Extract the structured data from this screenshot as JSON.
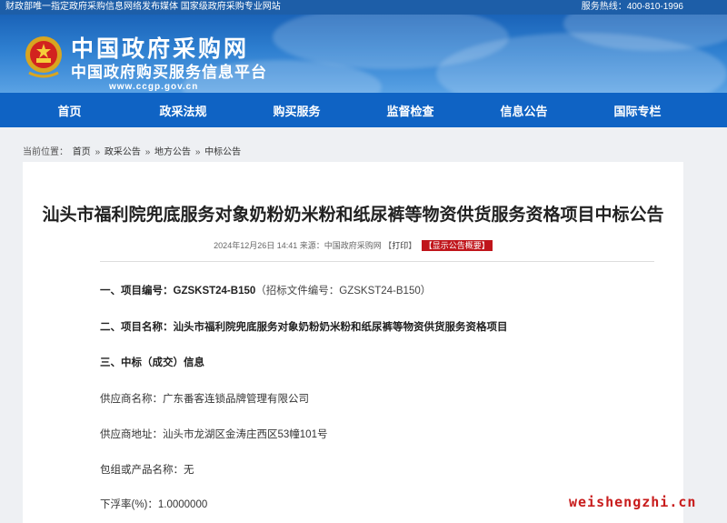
{
  "topbar": {
    "left": "财政部唯一指定政府采购信息网络发布媒体  国家级政府采购专业网站",
    "right": "服务热线：400-810-1996"
  },
  "banner": {
    "title_cn": "中国政府采购网",
    "subtitle_cn": "中国政府购买服务信息平台",
    "url": "www.ccgp.gov.cn"
  },
  "nav": {
    "items": [
      {
        "label": "首页"
      },
      {
        "label": "政采法规"
      },
      {
        "label": "购买服务"
      },
      {
        "label": "监督检查"
      },
      {
        "label": "信息公告"
      },
      {
        "label": "国际专栏"
      }
    ]
  },
  "breadcrumb": {
    "prefix": "当前位置：",
    "items": [
      "首页",
      "政采公告",
      "地方公告",
      "中标公告"
    ],
    "sep": "»"
  },
  "article": {
    "title": "汕头市福利院兜底服务对象奶粉奶米粉和纸尿裤等物资供货服务资格项目中标公告",
    "meta_text": "2024年12月26日 14:41 来源：中国政府采购网 【",
    "print_label": "打印",
    "meta_close": "】",
    "summary_button": "【显示公告概要】",
    "paragraphs": [
      {
        "label": "一、项目编号：",
        "value": "GZSKST24-B150",
        "extra": "（招标文件编号：GZSKST24-B150）"
      },
      {
        "label": "二、项目名称：",
        "value": "汕头市福利院兜底服务对象奶粉奶米粉和纸尿裤等物资供货服务资格项目"
      },
      {
        "label": "三、中标（成交）信息"
      },
      {
        "text": "供应商名称：广东番客连锁品牌管理有限公司"
      },
      {
        "text": "供应商地址：汕头市龙湖区金涛庄西区53幢101号"
      },
      {
        "text": "包组或产品名称：无"
      },
      {
        "text": "下浮率(%)：1.0000000"
      }
    ]
  },
  "watermark": "weishengzhi.cn",
  "colors": {
    "topbar": "#1d5ea8",
    "nav": "#0f63c4",
    "badge": "#c0151b",
    "watermark": "#c81c1c"
  }
}
